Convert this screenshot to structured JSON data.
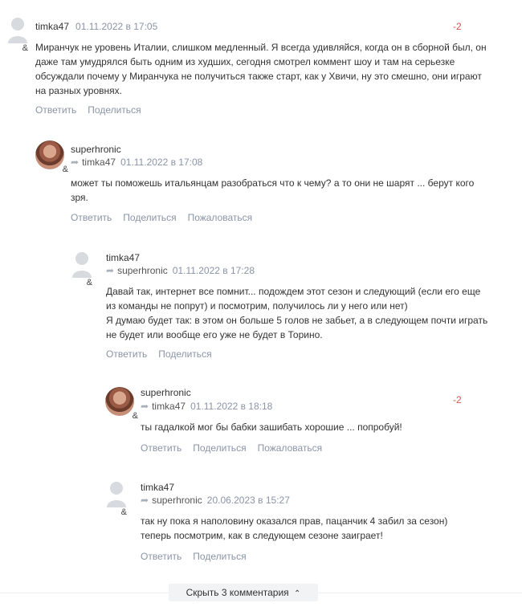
{
  "comments": [
    {
      "author": "timka47",
      "date": "01.11.2022 в 17:05",
      "score": "-2",
      "text": "Миранчук не уровень Италии, слишком медленный. Я всегда удивляйся, когда он в сборной был, он даже там умудрялся быть одним из худших, сегодня смотрел коммент шоу и там на серьезке обсуждали почему у Миранчука не получиться также старт, как у Хвичи, ну это смешно, они играют на разных уровнях.",
      "actions": [
        "Ответить",
        "Поделиться"
      ]
    },
    {
      "author": "superhronic",
      "reply_to": "timka47",
      "date": "01.11.2022 в 17:08",
      "text": "может ты поможешь итальянцам разобраться что к чему? а то они не шарят ... берут кого зря.",
      "actions": [
        "Ответить",
        "Поделиться",
        "Пожаловаться"
      ]
    },
    {
      "author": "timka47",
      "reply_to": "superhronic",
      "date": "01.11.2022 в 17:28",
      "text_lines": [
        "Давай так, интернет все помнит... подождем этот сезон и следующий (если его еще из команды не попрут) и посмотрим, получилось ли у него или нет)",
        "Я думаю будет так: в этом он больше 5 голов не забьет, а в следующем почти играть не будет или вообще его уже не будет в Торино."
      ],
      "actions": [
        "Ответить",
        "Поделиться"
      ]
    },
    {
      "author": "superhronic",
      "reply_to": "timka47",
      "date": "01.11.2022 в 18:18",
      "score": "-2",
      "text": "ты гадалкой мог бы бабки зашибать хорошие ... попробуй!",
      "actions": [
        "Ответить",
        "Поделиться",
        "Пожаловаться"
      ]
    },
    {
      "author": "timka47",
      "reply_to": "superhronic",
      "date": "20.06.2023 в 15:27",
      "text_lines": [
        "так ну пока я наполовину оказался прав, пацанчик 4 забил за сезон)",
        "теперь посмотрим, как в следующем сезоне заиграет!"
      ],
      "actions": [
        "Ответить",
        "Поделиться"
      ]
    }
  ],
  "hide_button": "Скрыть 3 комментария",
  "icons": {
    "avatar_default": "user-silhouette-icon",
    "reply_arrow": "reply-arrow-icon",
    "chevron": "chevron-up-icon"
  },
  "colors": {
    "score": "#d9534f",
    "muted": "#8a94a6"
  }
}
